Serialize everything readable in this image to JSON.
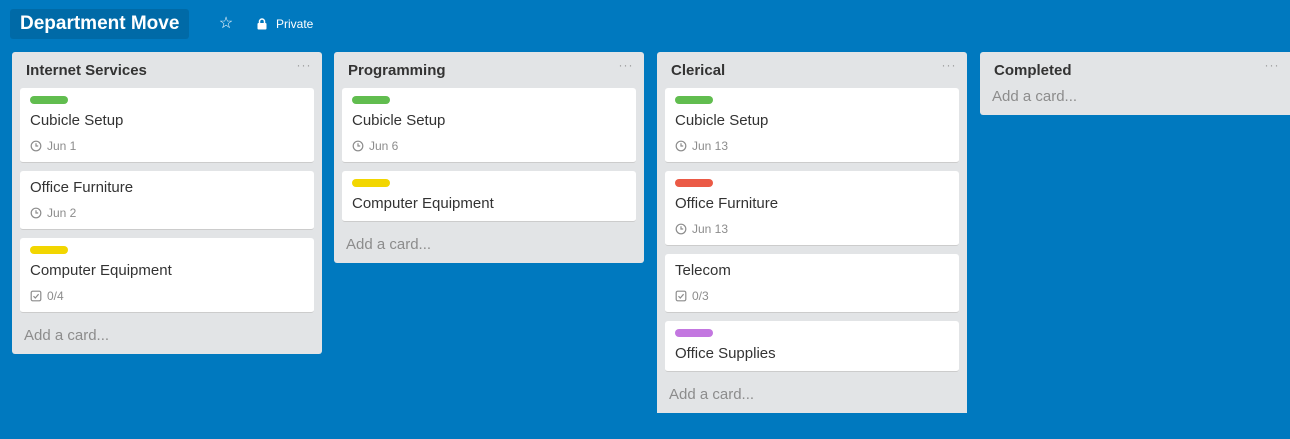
{
  "board": {
    "title": "Department Move",
    "privacy_label": "Private"
  },
  "colors": {
    "board_bg": "#0079bf",
    "label_green": "#61bd4f",
    "label_yellow": "#f2d600",
    "label_red": "#eb5a46",
    "label_purple": "#c377e0"
  },
  "lists": [
    {
      "title": "Internet Services",
      "menu_label": "···",
      "add_card_label": "Add a card...",
      "cards": [
        {
          "label_color": "green",
          "title": "Cubicle Setup",
          "badge_type": "due",
          "badge_text": "Jun 1"
        },
        {
          "label_color": "",
          "title": "Office Furniture",
          "badge_type": "due",
          "badge_text": "Jun 2"
        },
        {
          "label_color": "yellow",
          "title": "Computer Equipment",
          "badge_type": "checklist",
          "badge_text": "0/4"
        }
      ]
    },
    {
      "title": "Programming",
      "menu_label": "···",
      "add_card_label": "Add a card...",
      "cards": [
        {
          "label_color": "green",
          "title": "Cubicle Setup",
          "badge_type": "due",
          "badge_text": "Jun 6"
        },
        {
          "label_color": "yellow",
          "title": "Computer Equipment",
          "badge_type": "",
          "badge_text": ""
        }
      ]
    },
    {
      "title": "Clerical",
      "menu_label": "···",
      "add_card_label": "Add a card...",
      "cards": [
        {
          "label_color": "green",
          "title": "Cubicle Setup",
          "badge_type": "due",
          "badge_text": "Jun 13"
        },
        {
          "label_color": "red",
          "title": "Office Furniture",
          "badge_type": "due",
          "badge_text": "Jun 13"
        },
        {
          "label_color": "",
          "title": "Telecom",
          "badge_type": "checklist",
          "badge_text": "0/3"
        },
        {
          "label_color": "purple",
          "title": "Office Supplies",
          "badge_type": "",
          "badge_text": ""
        }
      ]
    },
    {
      "title": "Completed",
      "menu_label": "···",
      "add_card_label": "Add a card...",
      "cards": []
    }
  ]
}
